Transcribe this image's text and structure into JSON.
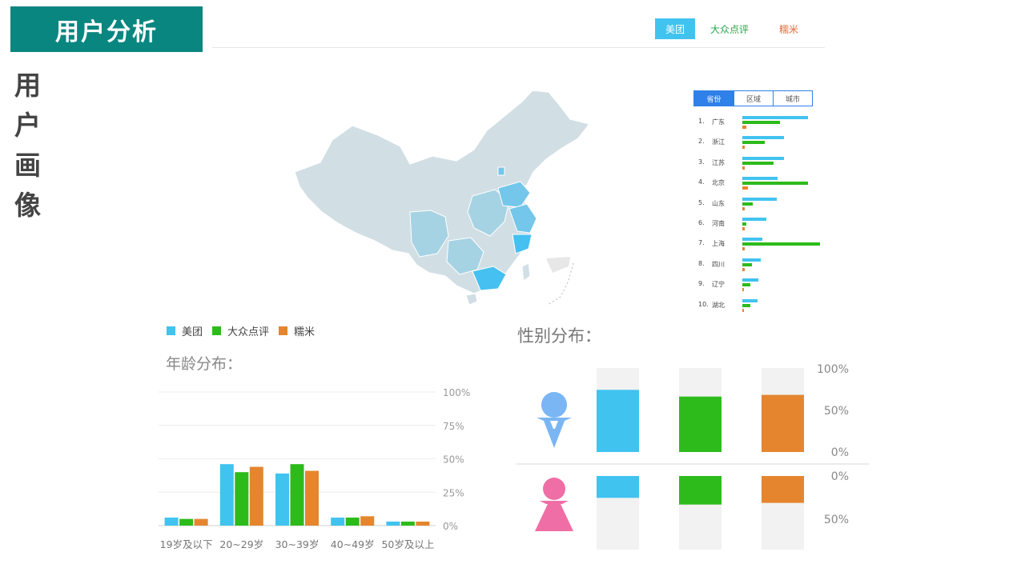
{
  "header": {
    "title": "用户分析",
    "side_title_chars": [
      "用",
      "户",
      "画",
      "像"
    ]
  },
  "brand_tabs": [
    {
      "label": "美团",
      "color": "#41c3f0",
      "active": true
    },
    {
      "label": "大众点评",
      "color": "#26a64a",
      "active": false
    },
    {
      "label": "糯米",
      "color": "#e46a3b",
      "active": false
    }
  ],
  "geo_tabs": [
    {
      "label": "省份",
      "active": true
    },
    {
      "label": "区域",
      "active": false
    },
    {
      "label": "城市",
      "active": false
    }
  ],
  "map": {
    "colors": {
      "base": "#d1dfe5",
      "mid": "#a6d3e3",
      "high": "#74c6ea",
      "top": "#45c0f0"
    }
  },
  "legend": [
    {
      "label": "美团",
      "color": "#41c3f0"
    },
    {
      "label": "大众点评",
      "color": "#2dbb1b"
    },
    {
      "label": "糯米",
      "color": "#e5862f"
    }
  ],
  "age_title": "年龄分布：",
  "gender_title": "性别分布：",
  "chart_data": [
    {
      "type": "bar",
      "orientation": "horizontal",
      "title": "",
      "categories": [
        "广东",
        "浙江",
        "江苏",
        "北京",
        "山东",
        "河南",
        "上海",
        "四川",
        "辽宁",
        "湖北"
      ],
      "rank_numbers": [
        "1.",
        "2.",
        "3.",
        "4.",
        "5.",
        "6.",
        "7.",
        "8.",
        "9.",
        "10."
      ],
      "series": [
        {
          "name": "美团",
          "color": "#41c3f0",
          "values": [
            82,
            52,
            52,
            44,
            43,
            30,
            25,
            23,
            20,
            19
          ]
        },
        {
          "name": "大众点评",
          "color": "#2dbb1b",
          "values": [
            47,
            28,
            39,
            82,
            13,
            5,
            97,
            12,
            10,
            10
          ]
        },
        {
          "name": "糯米",
          "color": "#e5862f",
          "values": [
            5,
            3,
            3,
            7,
            3,
            3,
            3,
            3,
            2,
            2
          ]
        }
      ]
    },
    {
      "type": "bar",
      "title": "年龄分布：",
      "categories": [
        "19岁及以下",
        "20~29岁",
        "30~39岁",
        "40~49岁",
        "50岁及以上"
      ],
      "series": [
        {
          "name": "美团",
          "color": "#41c3f0",
          "values": [
            6,
            46,
            39,
            6,
            3
          ]
        },
        {
          "name": "大众点评",
          "color": "#2dbb1b",
          "values": [
            5,
            40,
            46,
            6,
            3
          ]
        },
        {
          "name": "糯米",
          "color": "#e5862f",
          "values": [
            5,
            44,
            41,
            7,
            3
          ]
        }
      ],
      "ylim": [
        0,
        100
      ],
      "yticks": [
        "0%",
        "25%",
        "50%",
        "75%",
        "100%"
      ],
      "grid": true
    },
    {
      "type": "bar",
      "title": "性别分布：",
      "categories": [
        "美团",
        "大众点评",
        "糯米"
      ],
      "colors": [
        "#41c3f0",
        "#2dbb1b",
        "#e5862f"
      ],
      "series": [
        {
          "name": "",
          "values": [
            74,
            66,
            68
          ]
        },
        {
          "name": "",
          "values": [
            26,
            34,
            32
          ]
        }
      ],
      "yticks_top": [
        "100%",
        "50%",
        "0%"
      ],
      "yticks_bottom": [
        "0%",
        "50%"
      ],
      "icon_colors": {
        "male": "#7bb6f4",
        "female": "#f06ea6"
      }
    }
  ]
}
